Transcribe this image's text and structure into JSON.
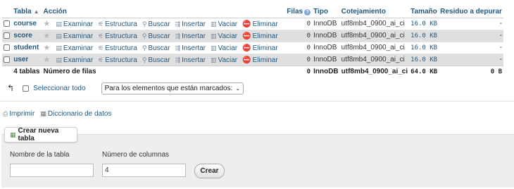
{
  "table": {
    "headers": {
      "table": "Tabla",
      "action": "Acción",
      "rows": "Filas",
      "type": "Tipo",
      "collation": "Cotejamiento",
      "size": "Tamaño",
      "overhead": "Residuo a depurar"
    },
    "actions": {
      "browse": "Examinar",
      "structure": "Estructura",
      "search": "Buscar",
      "insert": "Insertar",
      "empty": "Vaciar",
      "drop": "Eliminar"
    },
    "rows": [
      {
        "name": "course",
        "rows": "0",
        "type": "InnoDB",
        "collation": "utf8mb4_0900_ai_ci",
        "size": "16.0 KB",
        "overhead": "-"
      },
      {
        "name": "score",
        "rows": "0",
        "type": "InnoDB",
        "collation": "utf8mb4_0900_ai_ci",
        "size": "16.0 KB",
        "overhead": "-"
      },
      {
        "name": "student",
        "rows": "0",
        "type": "InnoDB",
        "collation": "utf8mb4_0900_ai_ci",
        "size": "16.0 KB",
        "overhead": "-"
      },
      {
        "name": "user",
        "rows": "0",
        "type": "InnoDB",
        "collation": "utf8mb4_0900_ai_ci",
        "size": "16.0 KB",
        "overhead": "-"
      }
    ],
    "footer": {
      "count": "4 tablas",
      "label": "Número de filas",
      "rows": "0",
      "type": "InnoDB",
      "collation": "utf8mb4_0900_ai_ci",
      "size": "64.0 KB",
      "overhead": "0 B"
    }
  },
  "selection": {
    "select_all": "Seleccionar todo",
    "with_selected": "Para los elementos que están marcados:"
  },
  "links": {
    "print": "Imprimir",
    "data_dictionary": "Diccionario de datos"
  },
  "create": {
    "tab_label": "Crear nueva tabla",
    "name_label": "Nombre de la tabla",
    "name_value": "",
    "columns_label": "Número de columnas",
    "columns_value": "4",
    "submit": "Crear"
  },
  "colors": {
    "link": "#235a81",
    "drop_icon": "#dd3d33",
    "row_alt": "#dfdfdf",
    "panel_bg": "#eeeeee"
  },
  "icons": [
    "star-icon",
    "browse-icon",
    "structure-icon",
    "search-icon",
    "insert-icon",
    "empty-icon",
    "drop-icon",
    "help-icon",
    "print-icon",
    "dictionary-icon",
    "new-table-icon",
    "arrow-up-icon",
    "caret-down-icon"
  ]
}
